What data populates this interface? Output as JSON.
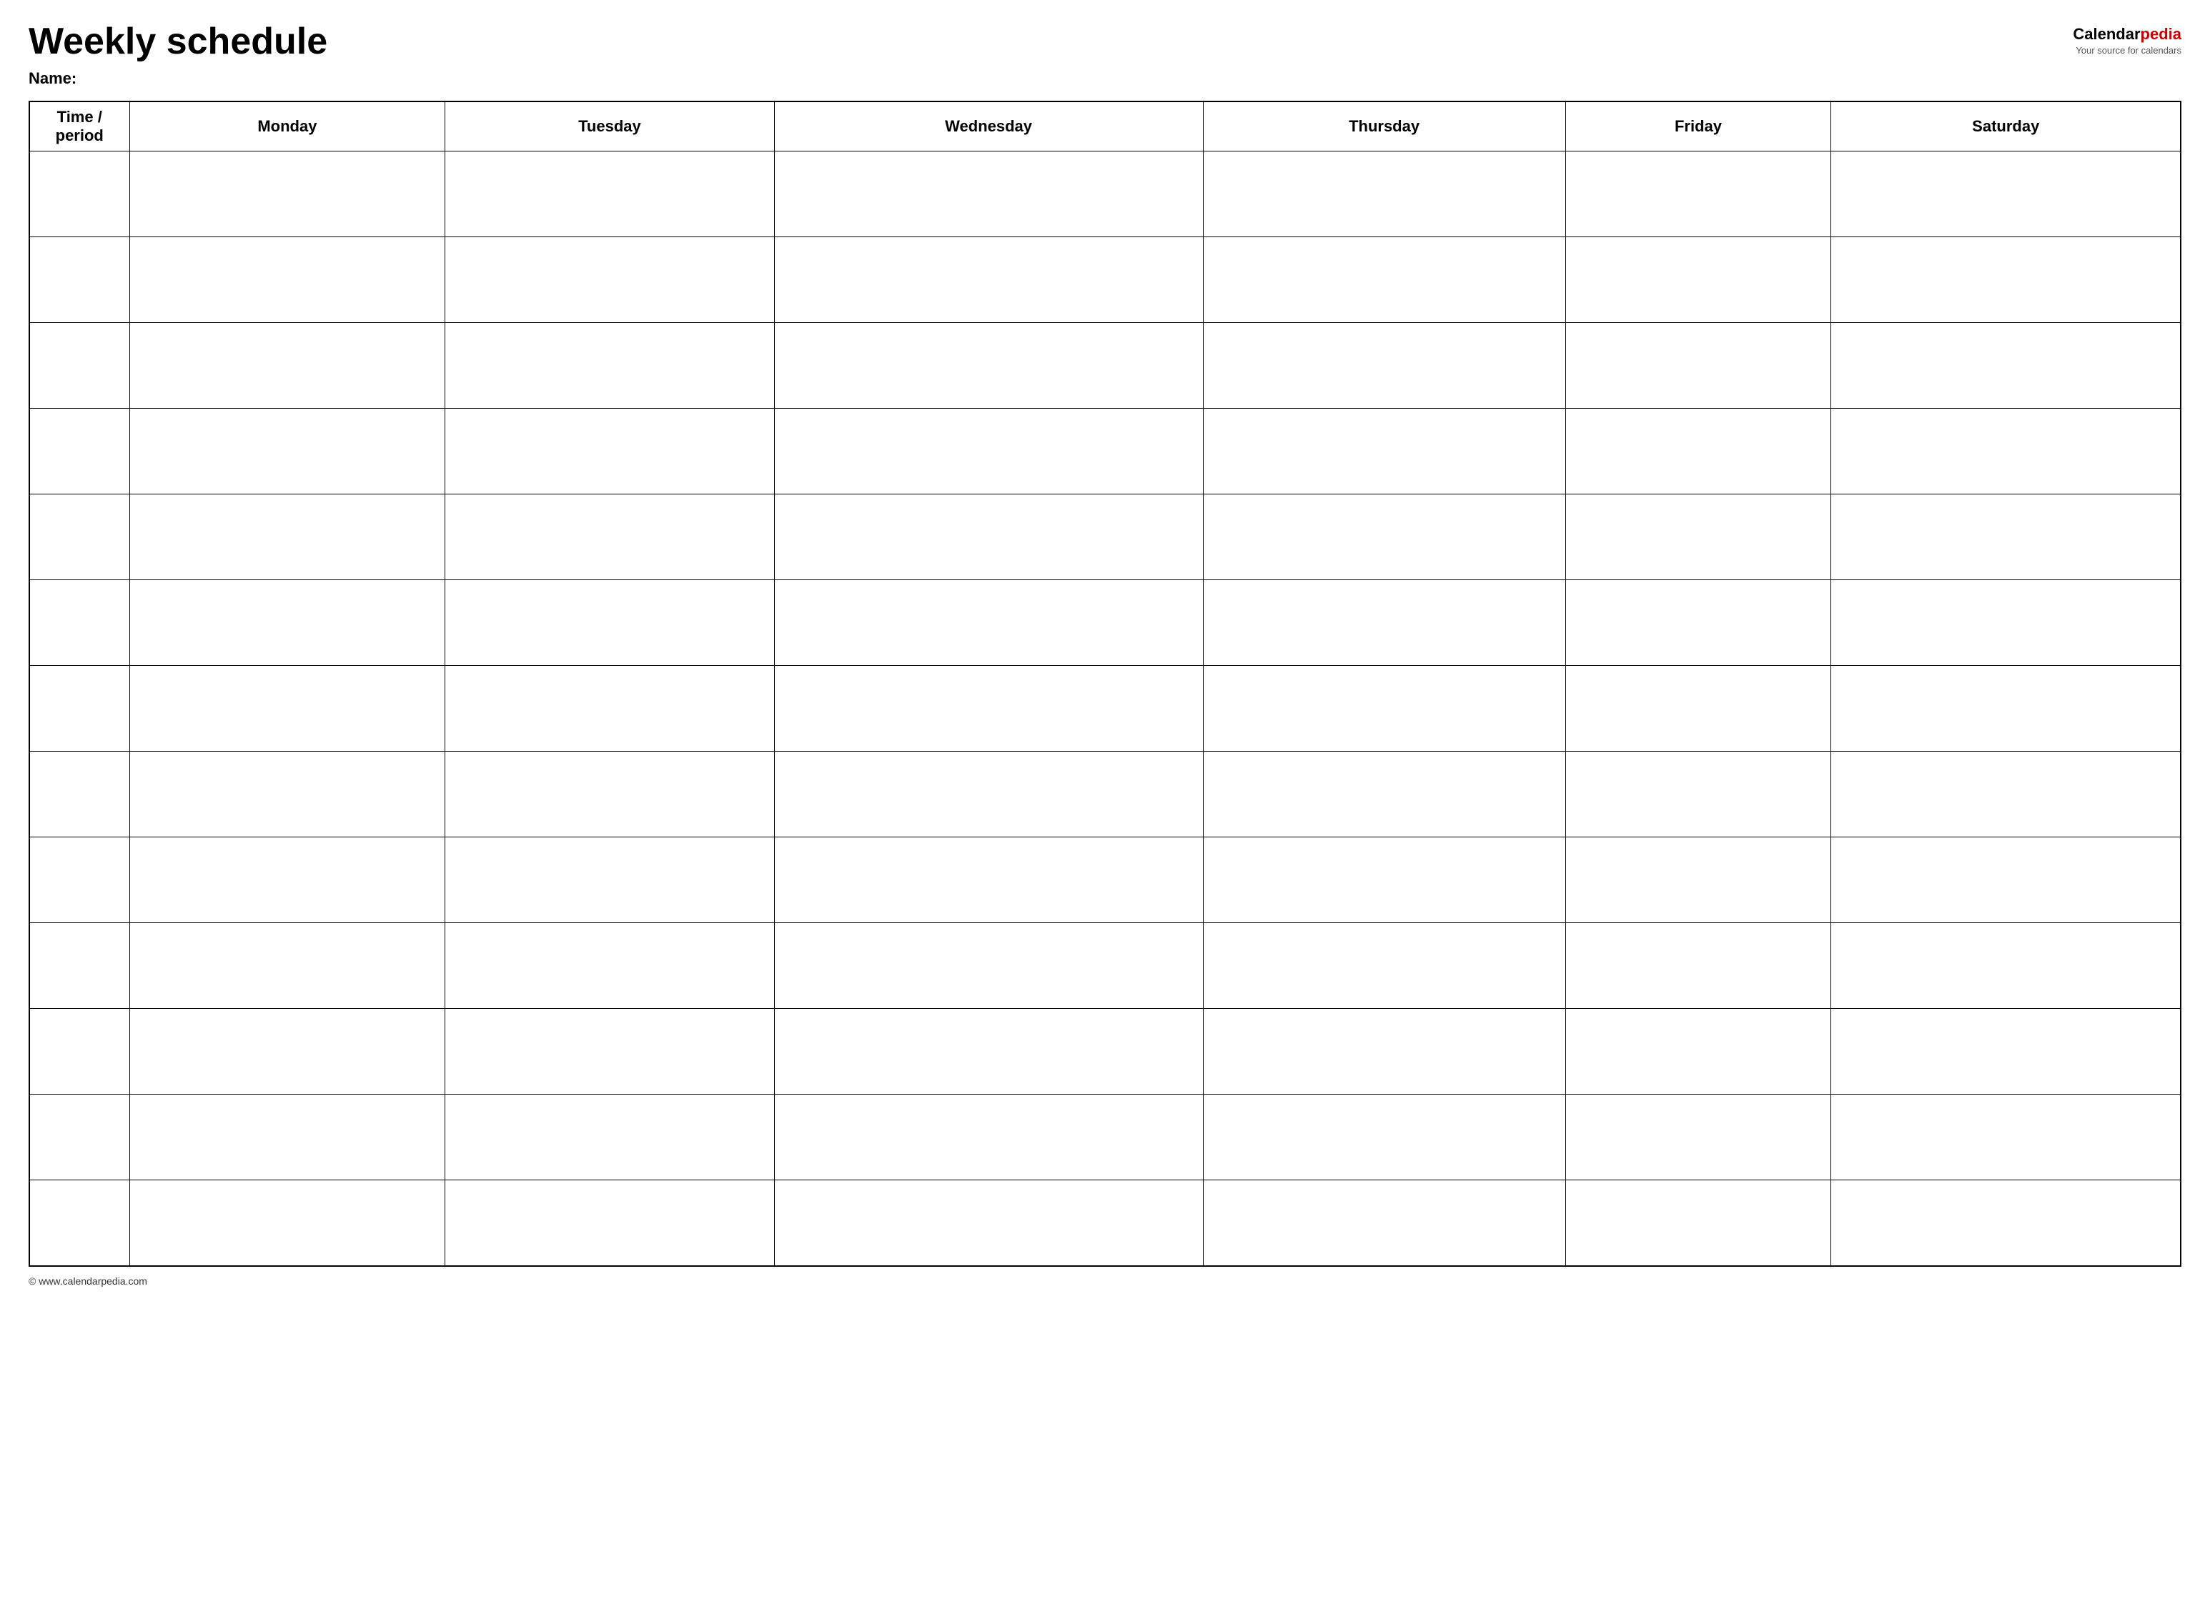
{
  "header": {
    "title": "Weekly schedule",
    "name_label": "Name:",
    "logo": {
      "calendar_part": "Calendar",
      "pedia_part": "pedia",
      "subtitle": "Your source for calendars"
    }
  },
  "table": {
    "columns": [
      {
        "id": "time",
        "label": "Time / period"
      },
      {
        "id": "monday",
        "label": "Monday"
      },
      {
        "id": "tuesday",
        "label": "Tuesday"
      },
      {
        "id": "wednesday",
        "label": "Wednesday"
      },
      {
        "id": "thursday",
        "label": "Thursday"
      },
      {
        "id": "friday",
        "label": "Friday"
      },
      {
        "id": "saturday",
        "label": "Saturday"
      }
    ],
    "rows": [
      {
        "time": ""
      },
      {
        "time": ""
      },
      {
        "time": ""
      },
      {
        "time": ""
      },
      {
        "time": ""
      },
      {
        "time": ""
      },
      {
        "time": ""
      },
      {
        "time": ""
      },
      {
        "time": ""
      },
      {
        "time": ""
      },
      {
        "time": ""
      },
      {
        "time": ""
      },
      {
        "time": ""
      }
    ]
  },
  "footer": {
    "copyright": "© www.calendarpedia.com"
  }
}
